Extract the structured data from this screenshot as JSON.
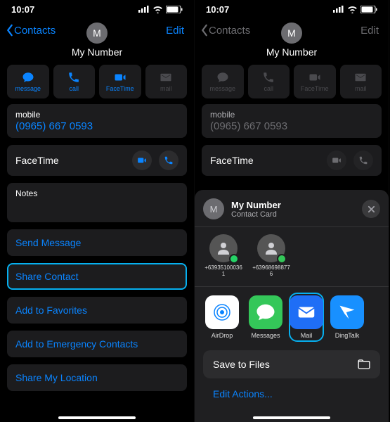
{
  "status": {
    "time": "10:07"
  },
  "nav": {
    "back": "Contacts",
    "edit": "Edit"
  },
  "contact": {
    "initial": "M",
    "name": "My Number"
  },
  "actions": {
    "message": "message",
    "call": "call",
    "facetime": "FaceTime",
    "mail": "mail"
  },
  "mobile": {
    "label": "mobile",
    "value": "(0965) 667 0593"
  },
  "facetime": {
    "label": "FaceTime"
  },
  "notes": {
    "label": "Notes"
  },
  "links": {
    "send_message": "Send Message",
    "share_contact": "Share Contact",
    "add_fav": "Add to Favorites",
    "add_emergency": "Add to Emergency Contacts",
    "share_loc": "Share My Location"
  },
  "sheet": {
    "title": "My Number",
    "subtitle": "Contact Card",
    "contacts": [
      {
        "label": "+639351000361"
      },
      {
        "label": "+639686988776"
      }
    ],
    "apps": {
      "airdrop": "AirDrop",
      "messages": "Messages",
      "mail": "Mail",
      "dingtalk": "DingTalk"
    },
    "save_files": "Save to Files",
    "edit_actions": "Edit Actions..."
  }
}
